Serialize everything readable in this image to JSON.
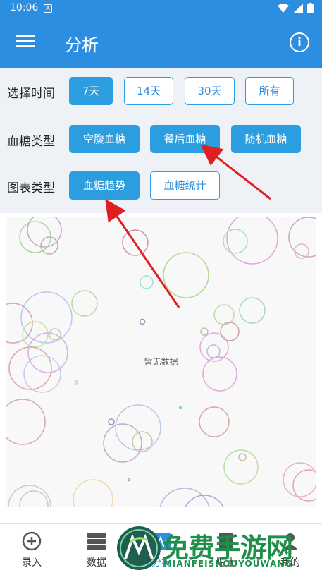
{
  "status": {
    "time": "10:06",
    "notif_glyph": "A"
  },
  "appbar": {
    "title": "分析",
    "menu_icon": "menu-icon",
    "info_icon": "info-icon"
  },
  "filters": {
    "time": {
      "label": "选择时间",
      "options": [
        "7天",
        "14天",
        "30天",
        "所有"
      ],
      "selected": "7天"
    },
    "glucose_type": {
      "label": "血糖类型",
      "options": [
        "空腹血糖",
        "餐后血糖",
        "随机血糖"
      ],
      "selected": [
        "空腹血糖",
        "餐后血糖",
        "随机血糖"
      ]
    },
    "chart_type": {
      "label": "图表类型",
      "options": [
        "血糖趋势",
        "血糖统计"
      ],
      "selected": "血糖趋势"
    }
  },
  "chart": {
    "empty_text": "暂无数据"
  },
  "tabs": [
    {
      "label": "录入",
      "icon": "plus-circle-icon"
    },
    {
      "label": "数据",
      "icon": "database-icon"
    },
    {
      "label": "分析",
      "icon": "chart-icon"
    },
    {
      "label": "贴士",
      "icon": "tip-icon"
    },
    {
      "label": "我的",
      "icon": "user-icon"
    }
  ],
  "watermark": {
    "text": "免费手游网",
    "sub": "MIANFEISHOUYOUWANG"
  },
  "colors": {
    "primary": "#2c8ee0",
    "button_active": "#2c9ee0",
    "filter_bg": "#eef1f5",
    "arrow": "#e02020",
    "watermark": "#1f8f4b"
  }
}
